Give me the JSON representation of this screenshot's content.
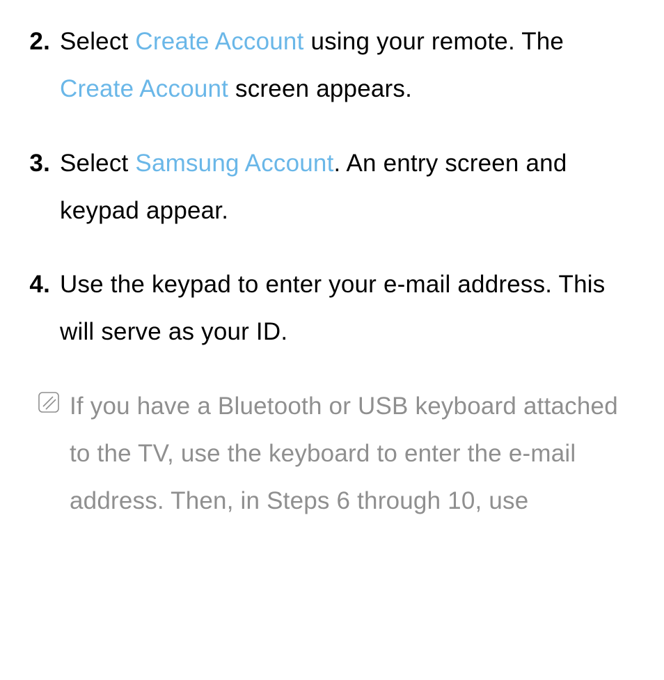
{
  "steps": [
    {
      "num": "2.",
      "runs": [
        {
          "t": "Select ",
          "hl": false
        },
        {
          "t": "Create Account",
          "hl": true
        },
        {
          "t": " using your remote. The ",
          "hl": false
        },
        {
          "t": "Create Account",
          "hl": true
        },
        {
          "t": " screen appears.",
          "hl": false
        }
      ]
    },
    {
      "num": "3.",
      "runs": [
        {
          "t": "Select ",
          "hl": false
        },
        {
          "t": "Samsung Account",
          "hl": true
        },
        {
          "t": ". An entry screen and keypad appear.",
          "hl": false
        }
      ]
    },
    {
      "num": "4.",
      "runs": [
        {
          "t": "Use the keypad to enter your e-mail address. This will serve as your ID.",
          "hl": false
        }
      ]
    }
  ],
  "note": {
    "icon": "note-icon",
    "text": "If you have a Bluetooth or USB keyboard attached to the TV, use the keyboard to enter the e-mail address. Then, in Steps 6 through 10, use"
  }
}
